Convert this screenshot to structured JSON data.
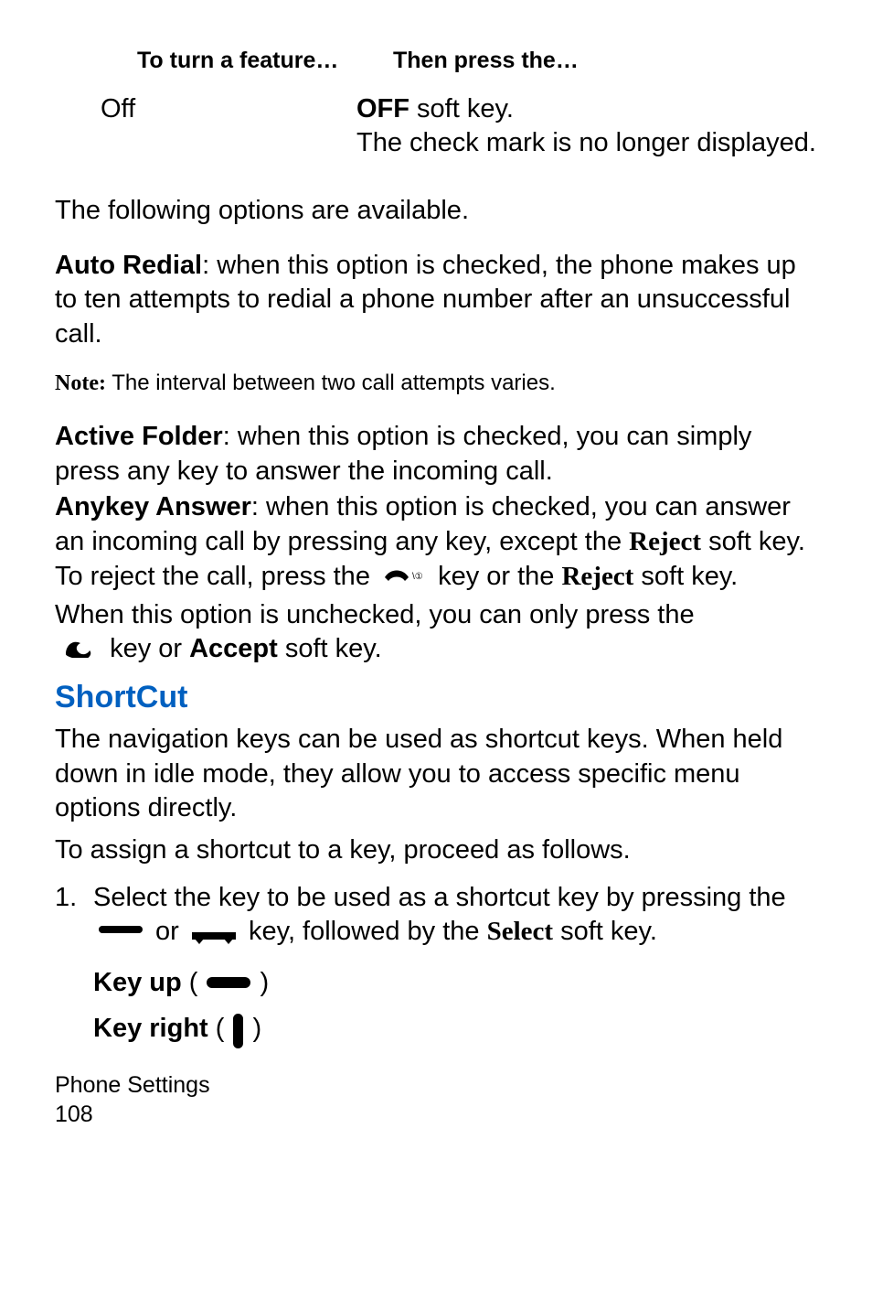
{
  "table": {
    "header": {
      "col1": "To turn a feature…",
      "col2": "Then press the…"
    },
    "row": {
      "col1": "Off",
      "col2_bold": "OFF",
      "col2_after_bold": " soft key.",
      "col2_line2": "The check mark is no longer displayed."
    }
  },
  "options_intro": "The following options are available.",
  "auto_redial": {
    "label": "Auto Redial",
    "text": ": when this option is checked, the phone makes up to ten attempts to redial a phone number after an unsuccessful call."
  },
  "note": {
    "label": "Note:",
    "text": " The interval between two call attempts varies."
  },
  "active_folder": {
    "label": "Active Folder",
    "text": ": when this option is checked, you can simply press any key to answer the incoming call."
  },
  "anykey": {
    "label": "Anykey Answer",
    "t1": ": when this option is checked, you can answer an incoming call by pressing any key, except the ",
    "reject1": "Reject",
    "t2": " soft key. To reject the call, press the ",
    "t3": " key or the ",
    "reject2": "Reject",
    "t4": " soft key."
  },
  "unchecked": {
    "t1": "When this option is unchecked, you can only press the ",
    "t2": " key or ",
    "accept": "Accept",
    "t3": " soft key."
  },
  "shortcut": {
    "heading": "ShortCut",
    "para": "The navigation keys can be used as shortcut keys. When held down in idle mode, they allow you to access specific menu options directly.",
    "assign": "To assign a shortcut to a key, proceed as follows."
  },
  "step1": {
    "num": "1.",
    "t1": "Select the key to be used as a shortcut key by pressing the ",
    "or": " or ",
    "t2": " key, followed by the ",
    "select": "Select",
    "t3": " soft key."
  },
  "key_up": {
    "label": "Key up",
    "paren_open": " ( ",
    "paren_close": " )"
  },
  "key_right": {
    "label": "Key right",
    "paren_open": " ( ",
    "paren_close": " )"
  },
  "footer": {
    "section": "Phone Settings",
    "pageno": "108"
  }
}
